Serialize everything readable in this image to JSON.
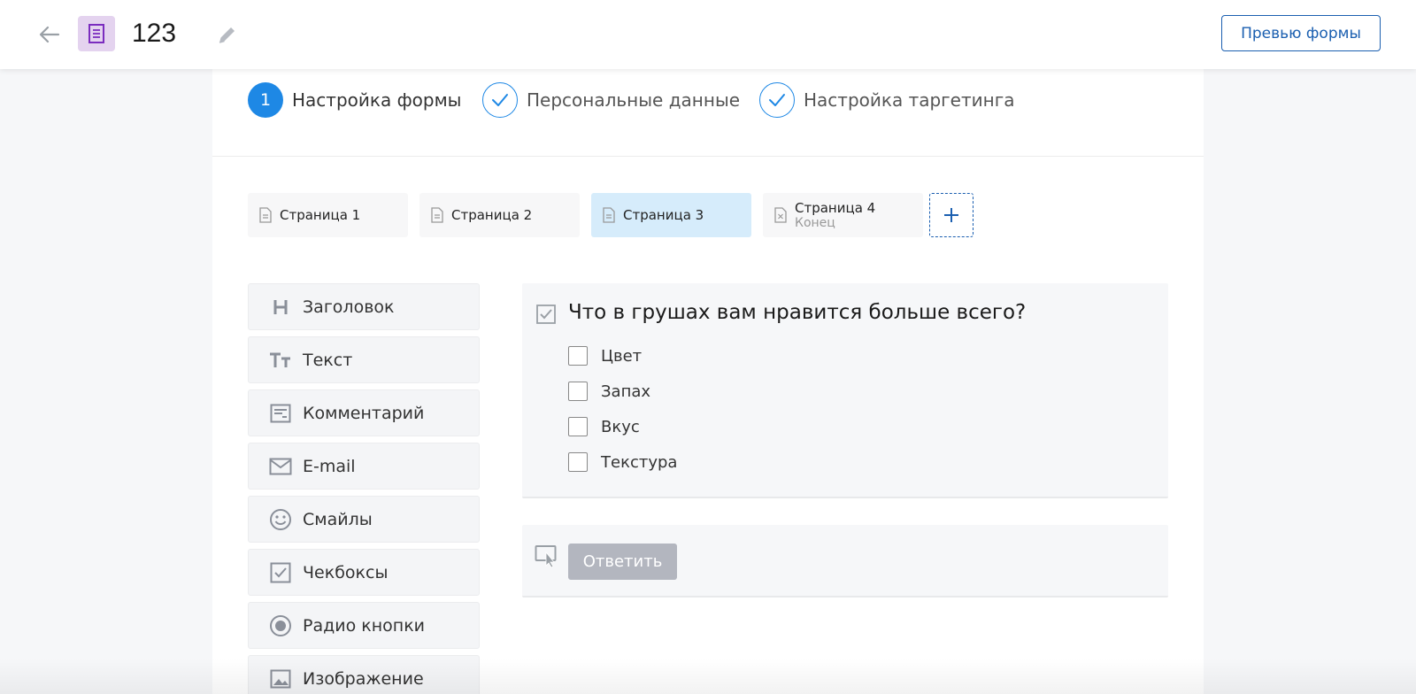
{
  "header": {
    "title": "123",
    "preview_label": "Превью формы"
  },
  "steps": [
    {
      "number": "1",
      "label": "Настройка формы",
      "state": "active"
    },
    {
      "number": "",
      "label": "Персональные данные",
      "state": "done"
    },
    {
      "number": "",
      "label": "Настройка таргетинга",
      "state": "done"
    }
  ],
  "pages": [
    {
      "label": "Страница 1",
      "sub": ""
    },
    {
      "label": "Страница 2",
      "sub": ""
    },
    {
      "label": "Страница 3",
      "sub": "",
      "active": true
    },
    {
      "label": "Страница 4",
      "sub": "Конец"
    }
  ],
  "palette": [
    {
      "label": "Заголовок",
      "icon": "heading-icon"
    },
    {
      "label": "Текст",
      "icon": "text-size-icon"
    },
    {
      "label": "Комментарий",
      "icon": "comment-icon"
    },
    {
      "label": "E-mail",
      "icon": "mail-icon"
    },
    {
      "label": "Смайлы",
      "icon": "smiley-icon"
    },
    {
      "label": "Чекбоксы",
      "icon": "checkbox-icon"
    },
    {
      "label": "Радио кнопки",
      "icon": "radio-icon"
    },
    {
      "label": "Изображение",
      "icon": "image-icon"
    }
  ],
  "question": {
    "title": "Что в грушах вам нравится больше всего?",
    "options": [
      "Цвет",
      "Запах",
      "Вкус",
      "Текстура"
    ]
  },
  "answer": {
    "button_label": "Ответить"
  },
  "colors": {
    "accent": "#1e88e5",
    "brand_blue": "#1b5fb0",
    "form_icon_bg": "#e4d3ef",
    "form_icon_fg": "#7b2cbf",
    "active_tab": "#d6ecfb",
    "disabled_button": "#b3b6bf"
  }
}
